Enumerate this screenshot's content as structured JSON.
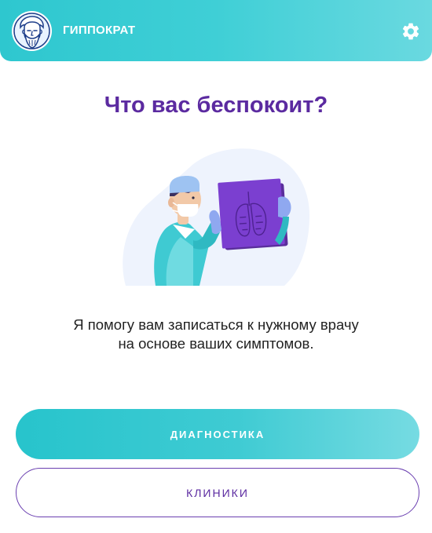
{
  "header": {
    "title": "ГИППОКРАТ",
    "logo_icon": "hippocrates-portrait-icon",
    "settings_icon": "gear-icon"
  },
  "main": {
    "heading": "Что вас беспокоит?",
    "illustration": "doctor-examining-xray-illustration",
    "description_line1": "Я помогу вам записаться к нужному врачу",
    "description_line2": "на основе ваших симптомов."
  },
  "actions": {
    "diagnostics_label": "ДИАГНОСТИКА",
    "clinics_label": "КЛИНИКИ"
  },
  "colors": {
    "header_gradient_start": "#2ec7cf",
    "header_gradient_end": "#6ad9e0",
    "accent_purple": "#5b2aa0",
    "xray_purple": "#7b3fd0",
    "text_dark": "#222222"
  }
}
